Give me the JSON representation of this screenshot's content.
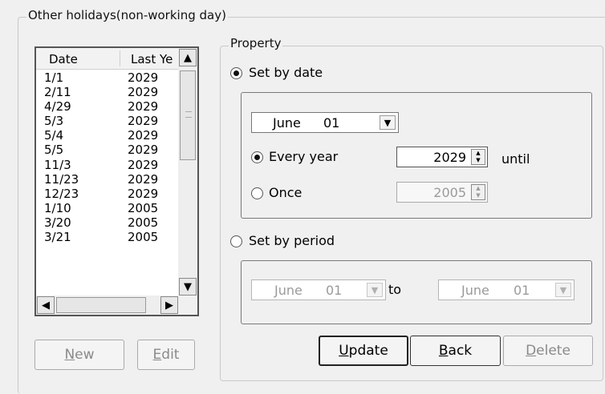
{
  "group_title": "Other holidays(non-working day)",
  "list": {
    "columns": [
      "Date",
      "Last Ye"
    ],
    "rows": [
      [
        "1/1",
        "2029"
      ],
      [
        "2/11",
        "2029"
      ],
      [
        "4/29",
        "2029"
      ],
      [
        "5/3",
        "2029"
      ],
      [
        "5/4",
        "2029"
      ],
      [
        "5/5",
        "2029"
      ],
      [
        "11/3",
        "2029"
      ],
      [
        "11/23",
        "2029"
      ],
      [
        "12/23",
        "2029"
      ],
      [
        "1/10",
        "2005"
      ],
      [
        "3/20",
        "2005"
      ],
      [
        "3/21",
        "2005"
      ]
    ]
  },
  "buttons": {
    "new": {
      "pre": "",
      "key": "N",
      "post": "ew"
    },
    "edit": {
      "pre": "",
      "key": "E",
      "post": "dit"
    },
    "update": {
      "pre": "",
      "key": "U",
      "post": "pdate"
    },
    "back": {
      "pre": "",
      "key": "B",
      "post": "ack"
    },
    "delete": {
      "pre": "",
      "key": "D",
      "post": "elete"
    }
  },
  "property": {
    "title": "Property",
    "set_by_date": {
      "label": "Set by date",
      "selected": true,
      "date_month": "June",
      "date_day": "01",
      "every_year_label": "Every year",
      "every_year_value": "2029",
      "until_label": "until",
      "once_label": "Once",
      "once_value": "2005"
    },
    "set_by_period": {
      "label": "Set by period",
      "selected": false,
      "from_month": "June",
      "from_day": "01",
      "to_label": "to",
      "to_month": "June",
      "to_day": "01"
    }
  },
  "icons": {
    "scroll_up": "▲",
    "scroll_down": "▼",
    "scroll_left": "◀",
    "scroll_right": "▶",
    "dropdown": "▼",
    "spin_up": "▲",
    "spin_down": "▼"
  }
}
